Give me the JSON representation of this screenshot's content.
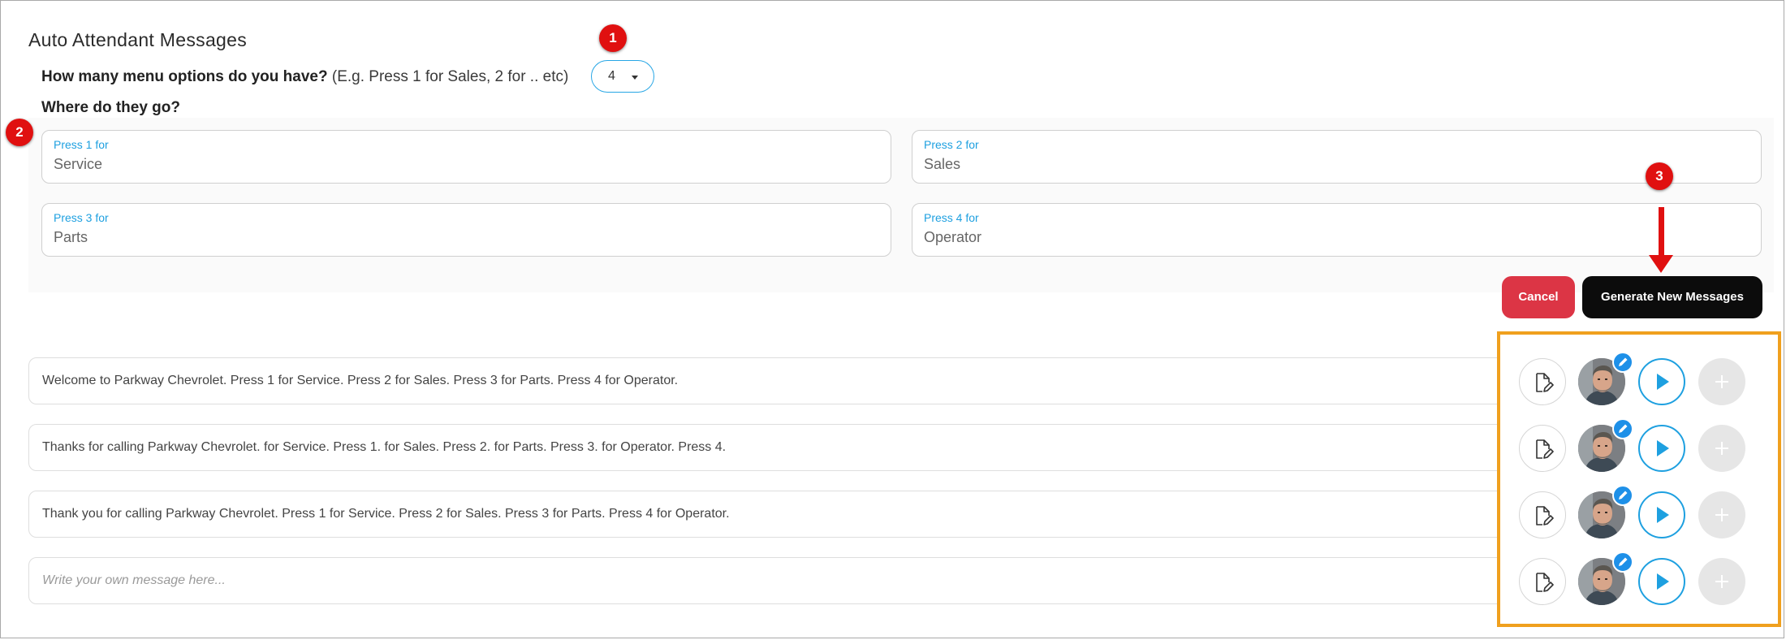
{
  "page": {
    "title": "Auto Attendant Messages",
    "question_menu": "How many menu options do you have?",
    "question_hint": "(E.g. Press 1 for Sales, 2 for .. etc)",
    "menu_count": "4",
    "question_where": "Where do they go?"
  },
  "fields": [
    {
      "label": "Press 1 for",
      "value": "Service"
    },
    {
      "label": "Press 2 for",
      "value": "Sales"
    },
    {
      "label": "Press 3 for",
      "value": "Parts"
    },
    {
      "label": "Press 4 for",
      "value": "Operator"
    }
  ],
  "actions": {
    "cancel_label": "Cancel",
    "generate_label": "Generate New Messages"
  },
  "messages": [
    {
      "text": "Welcome to Parkway Chevrolet. Press 1 for Service. Press 2 for Sales. Press 3 for Parts. Press 4 for Operator."
    },
    {
      "text": "Thanks for calling Parkway Chevrolet. for Service. Press 1. for Sales. Press 2. for Parts. Press 3. for Operator. Press 4."
    },
    {
      "text": "Thank you for calling Parkway Chevrolet. Press 1 for Service. Press 2 for Sales. Press 3 for Parts. Press 4 for Operator."
    },
    {
      "placeholder": "Write your own message here..."
    }
  ],
  "row_controls": {
    "icons": [
      "edit-document-icon",
      "avatar",
      "pencil-icon",
      "play-icon",
      "plus-icon"
    ]
  },
  "annotations": [
    "1",
    "2",
    "3"
  ],
  "colors": {
    "accent": "#1ea0e0",
    "cancel": "#dc3545",
    "generate": "#0c0c0c",
    "highlight_border": "#f0a01e",
    "marker": "#e01010"
  }
}
